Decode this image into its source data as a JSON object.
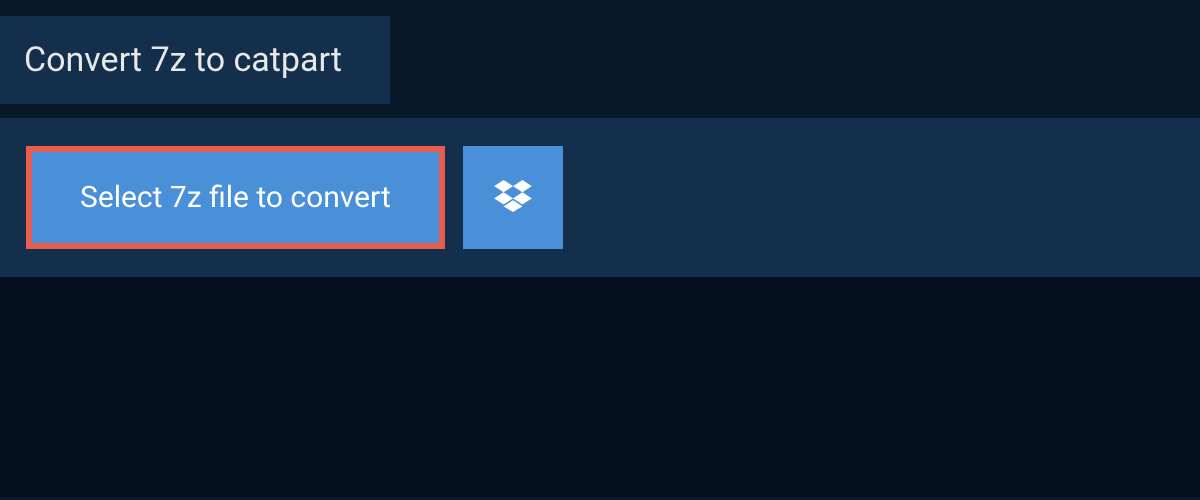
{
  "header": {
    "title": "Convert 7z to catpart"
  },
  "actions": {
    "select_file_label": "Select 7z file to convert",
    "dropbox_icon": "dropbox-icon"
  },
  "colors": {
    "background_dark": "#0a1929",
    "panel": "#132f4c",
    "button_primary": "#4a90d9",
    "button_highlight_border": "#e85d4e",
    "text_light": "#e8e8e8",
    "text_white": "#ffffff",
    "bottom_dark": "#04101f"
  }
}
